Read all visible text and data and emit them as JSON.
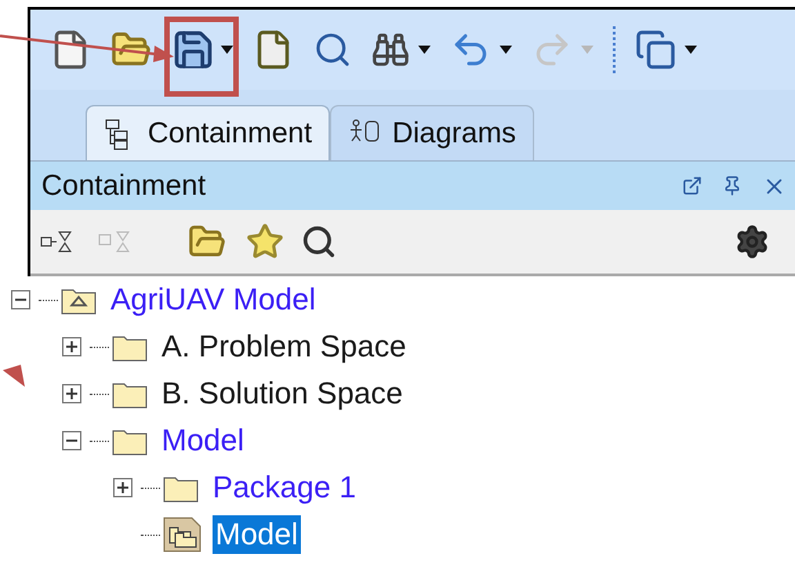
{
  "tabs": [
    {
      "label": "Containment",
      "selected": true,
      "kind": "containment"
    },
    {
      "label": "Diagrams",
      "selected": false,
      "kind": "diagrams"
    }
  ],
  "panel": {
    "title": "Containment"
  },
  "tree": [
    {
      "label": "AgriUAV Model",
      "kind": "model",
      "color": "#3b1ff5",
      "expanded": true,
      "selected": false,
      "children": [
        {
          "label": "A. Problem Space",
          "kind": "package",
          "color": "#1a1a1a",
          "expanded": false,
          "selected": false
        },
        {
          "label": "B. Solution Space",
          "kind": "package",
          "color": "#1a1a1a",
          "expanded": false,
          "selected": false
        },
        {
          "label": "Model",
          "kind": "package",
          "color": "#3b1ff5",
          "expanded": true,
          "selected": false,
          "children": [
            {
              "label": "Package 1",
              "kind": "package",
              "color": "#3b1ff5",
              "expanded": false,
              "selected": false
            },
            {
              "label": "Model",
              "kind": "diagram",
              "selected": true
            }
          ]
        }
      ]
    }
  ]
}
